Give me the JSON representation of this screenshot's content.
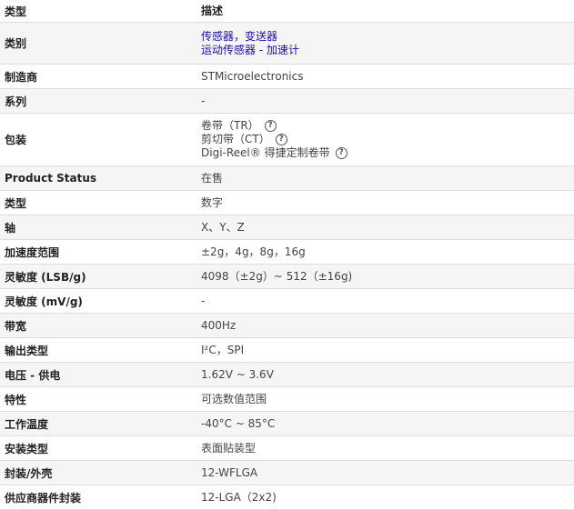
{
  "header": {
    "key": "类型",
    "value": "描述"
  },
  "category": {
    "key": "类别",
    "links": [
      "传感器，变送器",
      "运动传感器 - 加速计"
    ]
  },
  "manufacturer": {
    "key": "制造商",
    "value": "STMicroelectronics"
  },
  "series": {
    "key": "系列",
    "value": "-"
  },
  "packaging": {
    "key": "包装",
    "items": [
      "卷带（TR）",
      "剪切带（CT）",
      "Digi-Reel® 得捷定制卷带"
    ],
    "help_glyph": "?"
  },
  "rows": [
    {
      "key": "Product Status",
      "value": "在售"
    },
    {
      "key": "类型",
      "value": "数字"
    },
    {
      "key": "轴",
      "value": "X、Y、Z"
    },
    {
      "key": "加速度范围",
      "value": "±2g，4g，8g，16g"
    },
    {
      "key": "灵敏度 (LSB/g)",
      "value": "4098（±2g）~ 512（±16g)"
    },
    {
      "key": "灵敏度 (mV/g)",
      "value": "-"
    },
    {
      "key": "带宽",
      "value": "400Hz"
    },
    {
      "key": "输出类型",
      "value": "I²C，SPI"
    },
    {
      "key": "电压 - 供电",
      "value": "1.62V ~ 3.6V"
    },
    {
      "key": "特性",
      "value": "可选数值范围"
    },
    {
      "key": "工作温度",
      "value": "-40°C ~ 85°C"
    },
    {
      "key": "安装类型",
      "value": "表面贴装型"
    },
    {
      "key": "封装/外壳",
      "value": "12-WFLGA"
    },
    {
      "key": "供应商器件封装",
      "value": "12-LGA（2x2)"
    }
  ]
}
